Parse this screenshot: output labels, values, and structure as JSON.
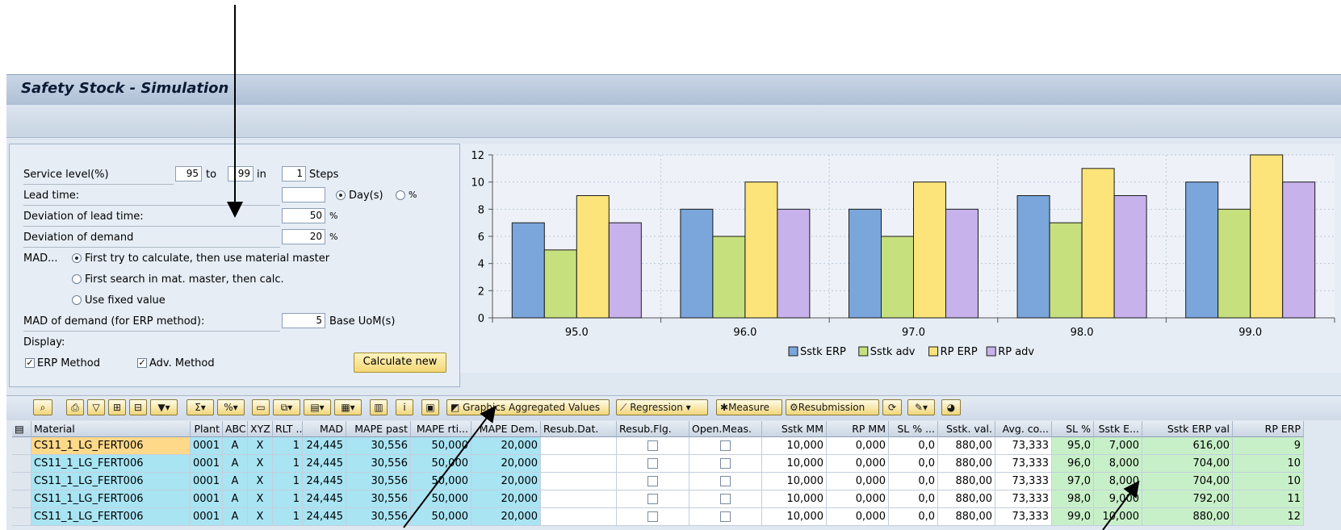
{
  "title": "Safety Stock - Simulation",
  "params": {
    "service_level_label": "Service level(%)",
    "sl_from": "95",
    "to_label": "to",
    "sl_to": "99",
    "in_label": "in",
    "steps": "1",
    "steps_label": "Steps",
    "lead_time_label": "Lead time:",
    "lead_time_value": "",
    "days_label": "Day(s)",
    "percent_label": "%",
    "dev_lead_label": "Deviation of lead time:",
    "dev_lead_value": "50",
    "dev_lead_unit": "%",
    "dev_demand_label": "Deviation of demand",
    "dev_demand_value": "20",
    "dev_demand_unit": "%",
    "mad_label": "MAD...",
    "mad_opt1": "First try to calculate, then use material master",
    "mad_opt2": "First search in mat. master, then calc.",
    "mad_opt3": "Use fixed value",
    "mad_demand_label": "MAD of demand (for ERP method):",
    "mad_demand_value": "5",
    "mad_demand_unit": "Base UoM(s)",
    "display_label": "Display:",
    "erp_method": "ERP Method",
    "adv_method": "Adv. Method",
    "calc_button": "Calculate new"
  },
  "toolbar": {
    "graphics_agg": "Graphics Aggregated Values",
    "regression": "Regression",
    "measure": "Measure",
    "resubmission": "Resubmission"
  },
  "chart_data": {
    "type": "bar",
    "categories": [
      "95.0",
      "96.0",
      "97.0",
      "98.0",
      "99.0"
    ],
    "series": [
      {
        "name": "Sstk ERP",
        "values": [
          7,
          8,
          8,
          9,
          10
        ],
        "color": "#7aa6dc"
      },
      {
        "name": "Sstk adv",
        "values": [
          5,
          6,
          6,
          7,
          8
        ],
        "color": "#c6e07e"
      },
      {
        "name": "RP ERP",
        "values": [
          9,
          10,
          10,
          11,
          12
        ],
        "color": "#fde47a"
      },
      {
        "name": "RP adv",
        "values": [
          7,
          8,
          8,
          9,
          10
        ],
        "color": "#c7b2ec"
      }
    ],
    "ylim": [
      0,
      12
    ],
    "yticks": [
      "0",
      "2",
      "4",
      "6",
      "8",
      "10",
      "12"
    ],
    "legend": "bottom",
    "grid": true
  },
  "table": {
    "columns": [
      "Material",
      "Plant",
      "ABC",
      "XYZ",
      "RLT ...",
      "MAD",
      "MAPE past",
      "MAPE rti...",
      "MAPE Dem.",
      "Resub.Dat.",
      "Resub.Flg.",
      "Open.Meas.",
      "Sstk MM",
      "RP MM",
      "SL % ...",
      "Sstk. val.",
      "Avg. co...",
      "SL %",
      "Sstk E...",
      "Sstk ERP val",
      "RP ERP"
    ],
    "rows": [
      [
        "CS11_1_LG_FERT006",
        "0001",
        "A",
        "X",
        "1",
        "24,445",
        "30,556",
        "50,000",
        "20,000",
        "",
        "",
        "",
        "10,000",
        "0,000",
        "0,0",
        "880,00",
        "73,333",
        "95,0",
        "7,000",
        "616,00",
        "9"
      ],
      [
        "CS11_1_LG_FERT006",
        "0001",
        "A",
        "X",
        "1",
        "24,445",
        "30,556",
        "50,000",
        "20,000",
        "",
        "",
        "",
        "10,000",
        "0,000",
        "0,0",
        "880,00",
        "73,333",
        "96,0",
        "8,000",
        "704,00",
        "10"
      ],
      [
        "CS11_1_LG_FERT006",
        "0001",
        "A",
        "X",
        "1",
        "24,445",
        "30,556",
        "50,000",
        "20,000",
        "",
        "",
        "",
        "10,000",
        "0,000",
        "0,0",
        "880,00",
        "73,333",
        "97,0",
        "8,000",
        "704,00",
        "10"
      ],
      [
        "CS11_1_LG_FERT006",
        "0001",
        "A",
        "X",
        "1",
        "24,445",
        "30,556",
        "50,000",
        "20,000",
        "",
        "",
        "",
        "10,000",
        "0,000",
        "0,0",
        "880,00",
        "73,333",
        "98,0",
        "9,000",
        "792,00",
        "11"
      ],
      [
        "CS11_1_LG_FERT006",
        "0001",
        "A",
        "X",
        "1",
        "24,445",
        "30,556",
        "50,000",
        "20,000",
        "",
        "",
        "",
        "10,000",
        "0,000",
        "0,0",
        "880,00",
        "73,333",
        "99,0",
        "10,000",
        "880,00",
        "12"
      ]
    ]
  }
}
